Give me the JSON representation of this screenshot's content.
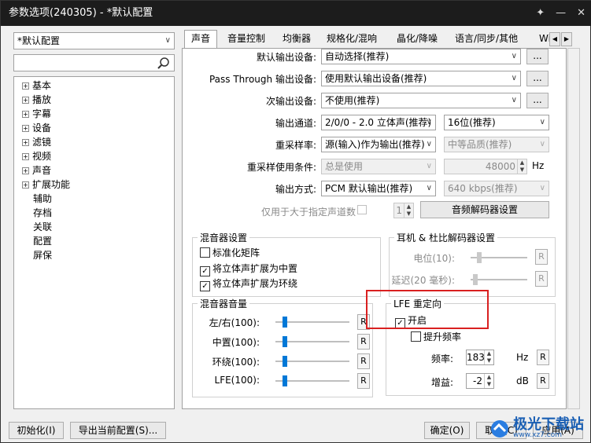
{
  "window": {
    "title": "参数选项(240305) - *默认配置",
    "controls": [
      "✦",
      "—",
      "✕"
    ]
  },
  "profile": {
    "selected": "*默认配置"
  },
  "search": {
    "value": ""
  },
  "tree": [
    {
      "label": "基本",
      "expand": "+"
    },
    {
      "label": "播放",
      "expand": "+"
    },
    {
      "label": "字幕",
      "expand": "+"
    },
    {
      "label": "设备",
      "expand": "+"
    },
    {
      "label": "滤镜",
      "expand": "+"
    },
    {
      "label": "视频",
      "expand": "+"
    },
    {
      "label": "声音",
      "expand": "+"
    },
    {
      "label": "扩展功能",
      "expand": "+"
    },
    {
      "label": "辅助",
      "expand": ""
    },
    {
      "label": "存档",
      "expand": ""
    },
    {
      "label": "关联",
      "expand": ""
    },
    {
      "label": "配置",
      "expand": ""
    },
    {
      "label": "屏保",
      "expand": ""
    }
  ],
  "tabs": [
    "声音",
    "音量控制",
    "均衡器",
    "规格化/混响",
    "晶化/降噪",
    "语言/同步/其他",
    "Wi"
  ],
  "tab_scroll": {
    "left": "◀",
    "right": "▶"
  },
  "audio": {
    "default_out_label": "默认输出设备:",
    "default_out_value": "自动选择(推荐)",
    "passthrough_label": "Pass Through 输出设备:",
    "passthrough_value": "使用默认输出设备(推荐)",
    "secondary_label": "次输出设备:",
    "secondary_value": "不使用(推荐)",
    "more": "...",
    "channel_label": "输出通道:",
    "channel_value": "2/0/0 - 2.0 立体声(推荐)",
    "bits_value": "16位(推荐)",
    "resample_label": "重采样率:",
    "resample_value": "源(输入)作为输出(推荐)",
    "quality_value": "中等品质(推荐)",
    "resample_cond_label": "重采样使用条件:",
    "resample_cond_value": "总是使用",
    "hz_value": "48000",
    "hz_unit": "Hz",
    "out_method_label": "输出方式:",
    "out_method_value": "PCM 默认输出(推荐)",
    "bitrate_value": "640 kbps(推荐)",
    "min_channels_label": "仅用于大于指定声道数",
    "min_channels_value": "1",
    "decoder_btn": "音频解码器设置"
  },
  "mixer": {
    "title": "混音器设置",
    "items": [
      {
        "label": "标准化矩阵",
        "checked": false
      },
      {
        "label": "将立体声扩展为中置",
        "checked": true
      },
      {
        "label": "将立体声扩展为环绕",
        "checked": true
      }
    ]
  },
  "headphone": {
    "title": "耳机 & 杜比解码器设置",
    "rows": [
      {
        "label": "电位(10):",
        "level": 0.12
      },
      {
        "label": "延迟(20 毫秒):",
        "level": 0.05
      }
    ]
  },
  "mixvol": {
    "title": "混音器音量",
    "rows": [
      {
        "label": "左/右(100):",
        "level": 0.1
      },
      {
        "label": "中置(100):",
        "level": 0.1
      },
      {
        "label": "环绕(100):",
        "level": 0.1
      },
      {
        "label": "LFE(100):",
        "level": 0.1
      }
    ]
  },
  "reset": "R",
  "lfe": {
    "title": "LFE 重定向",
    "enable_label": "开启",
    "enable_checked": true,
    "boost_label": "提升频率",
    "boost_checked": false,
    "freq_label": "频率:",
    "freq_value": "183",
    "freq_unit": "Hz",
    "gain_label": "增益:",
    "gain_value": "-2",
    "gain_unit": "dB"
  },
  "bottom": {
    "init": "初始化(I)",
    "export": "导出当前配置(S)...",
    "ok": "确定(O)",
    "cancel": "取消(C)",
    "apply": "应用(A)"
  },
  "watermark": {
    "text": "极光下载站",
    "url": "www.xz7.com"
  },
  "colors": {
    "accent": "#0078d7",
    "highlight": "#d92020",
    "titlebar": "#1c1c1c"
  }
}
